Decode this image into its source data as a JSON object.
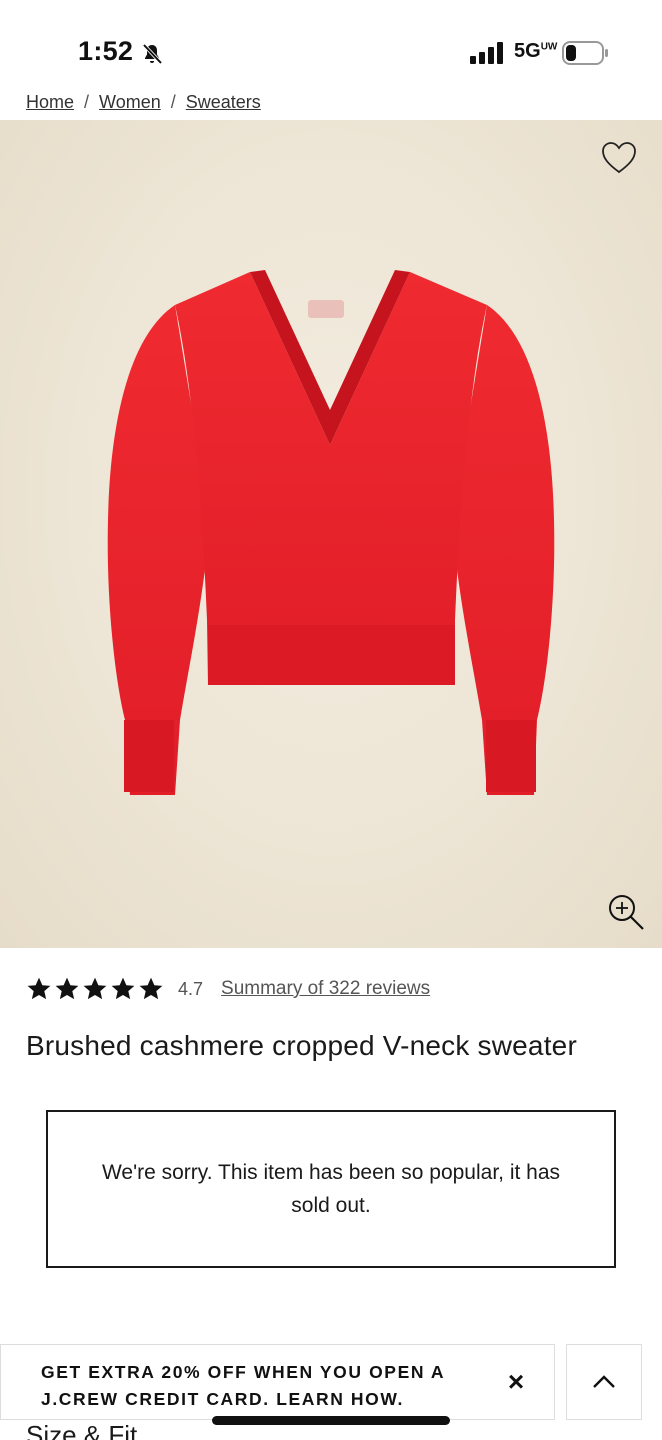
{
  "status": {
    "time": "1:52",
    "network": "5G",
    "network_superscript": "UW"
  },
  "breadcrumb": [
    "Home",
    "Women",
    "Sweaters"
  ],
  "hero": {
    "alt": "Red brushed cashmere cropped V-neck sweater"
  },
  "rating": {
    "stars": 5,
    "value": "4.7",
    "reviews_link": "Summary of 322 reviews"
  },
  "product": {
    "title": "Brushed cashmere cropped V-neck sweater"
  },
  "soldout": {
    "message": "We're sorry. This item has been so popular, it has sold out."
  },
  "section": {
    "size_fit": "Size & Fit"
  },
  "promo": {
    "text": "GET EXTRA 20% OFF WHEN YOU OPEN A J.CREW CREDIT CARD. LEARN HOW.",
    "close": "×"
  },
  "colors": {
    "sweater": "#e5202a",
    "background": "#ede5d5",
    "text": "#111111"
  },
  "icons": {
    "wishlist": "heart-outline-icon",
    "zoom": "zoom-in-icon",
    "back_to_top": "chevron-up-icon"
  }
}
